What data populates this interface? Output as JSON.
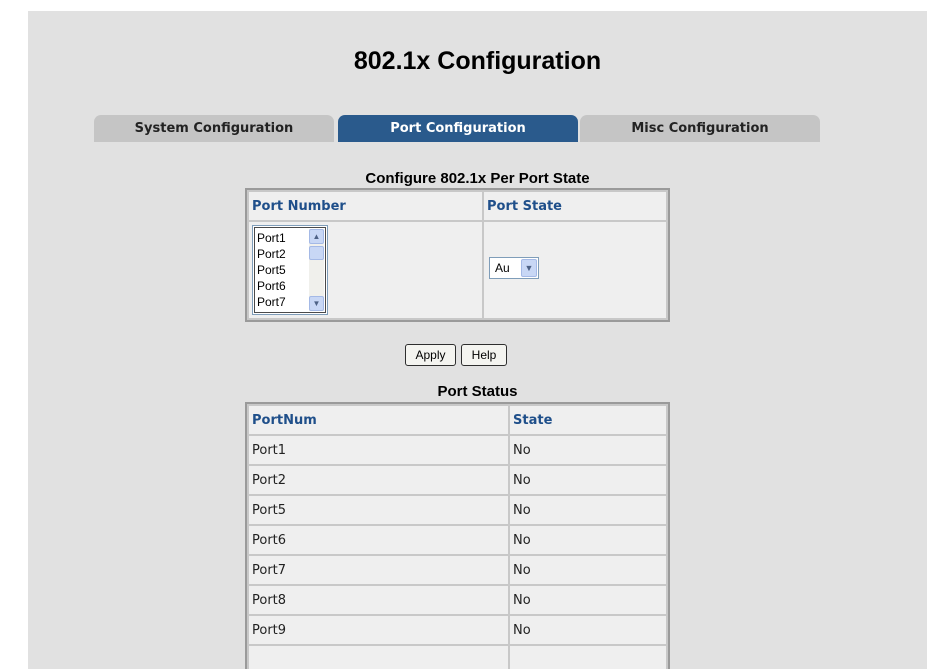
{
  "page": {
    "title": "802.1x Configuration"
  },
  "tabs": [
    {
      "label": "System Configuration",
      "active": false
    },
    {
      "label": "Port Configuration",
      "active": true
    },
    {
      "label": "Misc Configuration",
      "active": false
    }
  ],
  "per_port": {
    "title": "Configure 802.1x Per Port State",
    "col_port_number": "Port Number",
    "col_port_state": "Port State",
    "port_options": [
      "Port1",
      "Port2",
      "Port5",
      "Port6",
      "Port7"
    ],
    "state_value": "Au"
  },
  "buttons": {
    "apply": "Apply",
    "help": "Help"
  },
  "status": {
    "title": "Port Status",
    "col_portnum": "PortNum",
    "col_state": "State",
    "rows": [
      {
        "port": "Port1",
        "state": "No"
      },
      {
        "port": "Port2",
        "state": "No"
      },
      {
        "port": "Port5",
        "state": "No"
      },
      {
        "port": "Port6",
        "state": "No"
      },
      {
        "port": "Port7",
        "state": "No"
      },
      {
        "port": "Port8",
        "state": "No"
      },
      {
        "port": "Port9",
        "state": "No"
      }
    ]
  },
  "colors": {
    "active_tab": "#2a5a8c",
    "inactive_tab": "#c5c5c5",
    "header_text": "#1f4f8a",
    "panel_bg": "#e1e1e1"
  }
}
